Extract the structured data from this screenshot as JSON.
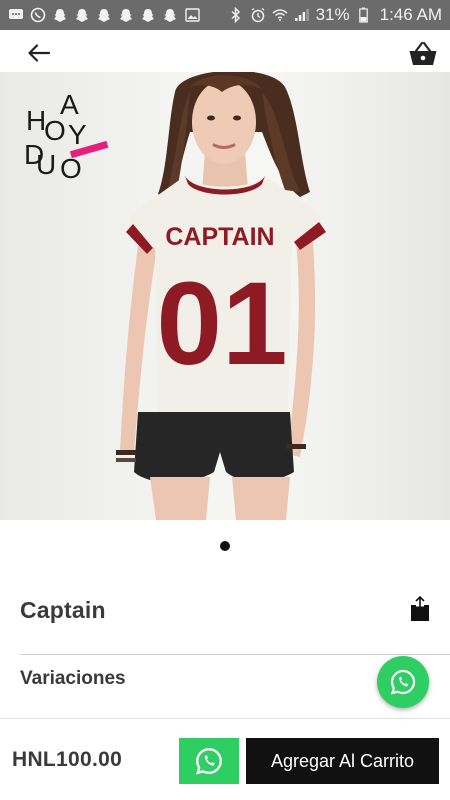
{
  "status_bar": {
    "battery_percent": "31%",
    "time": "1:46 AM",
    "left_icons": [
      "message-icon",
      "whatsapp-icon",
      "snapchat-icon",
      "snapchat-icon",
      "snapchat-icon",
      "snapchat-icon",
      "snapchat-icon",
      "snapchat-icon",
      "image-icon"
    ],
    "right_icons": [
      "bluetooth-icon",
      "alarm-icon",
      "wifi-icon",
      "signal-icon",
      "battery-icon"
    ]
  },
  "product": {
    "shirt_text": "CAPTAIN",
    "shirt_number": "01",
    "brand_logo_text": "HA DOY DUO",
    "title": "Captain",
    "price": "HNL100.00"
  },
  "sections": {
    "variations_label": "Variaciones"
  },
  "actions": {
    "add_to_cart_label": "Agregar Al Carrito"
  },
  "colors": {
    "whatsapp_green": "#2fce63",
    "shirt_red": "#8e1b24",
    "button_black": "#111111"
  }
}
